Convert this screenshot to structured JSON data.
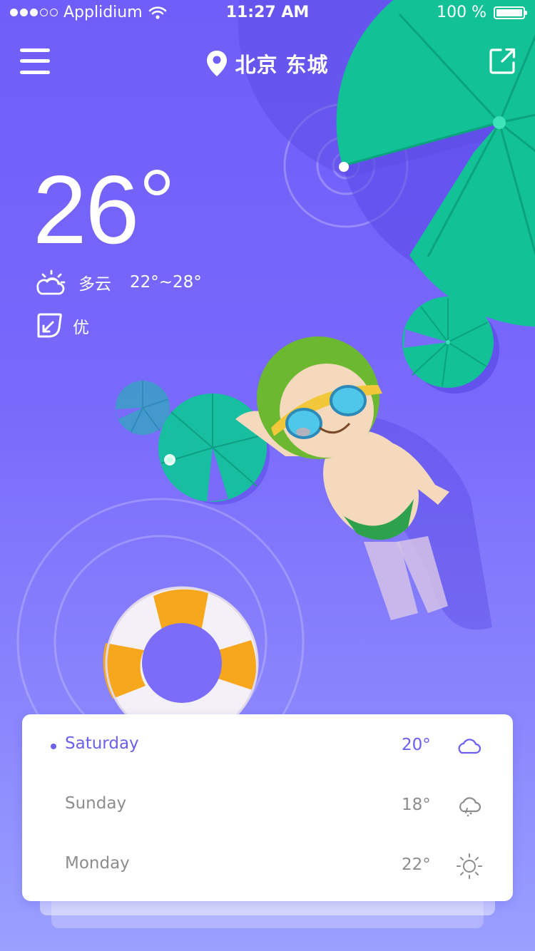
{
  "status_bar": {
    "carrier": "Applidium",
    "time": "11:27 AM",
    "battery": "100 %",
    "signal_bars": 3,
    "signal_total": 5,
    "battery_level_percent": 100
  },
  "header": {
    "location": "北京 东城",
    "icons": {
      "menu": "hamburger-menu-icon",
      "location": "map-pin-icon",
      "share": "share-icon"
    }
  },
  "current": {
    "temperature": "26",
    "condition": "多云",
    "range": "22°~28°",
    "air_quality": "优",
    "icons": {
      "condition": "partly-cloudy-icon",
      "air_quality": "leaf-icon"
    }
  },
  "forecast": [
    {
      "day": "Saturday",
      "temp": "20°",
      "icon": "cloud-icon",
      "active": true
    },
    {
      "day": "Sunday",
      "temp": "18°",
      "icon": "rain-cloud-icon",
      "active": false
    },
    {
      "day": "Monday",
      "temp": "22°",
      "icon": "sun-icon",
      "active": false
    }
  ],
  "colors": {
    "background_top": "#6f5ef9",
    "background_bottom": "#9aa0fe",
    "accent": "#6a5ff0",
    "lily_pad": "#12c196",
    "float_ring": "#f7a71c",
    "inactive_text": "#8d8d8d"
  }
}
